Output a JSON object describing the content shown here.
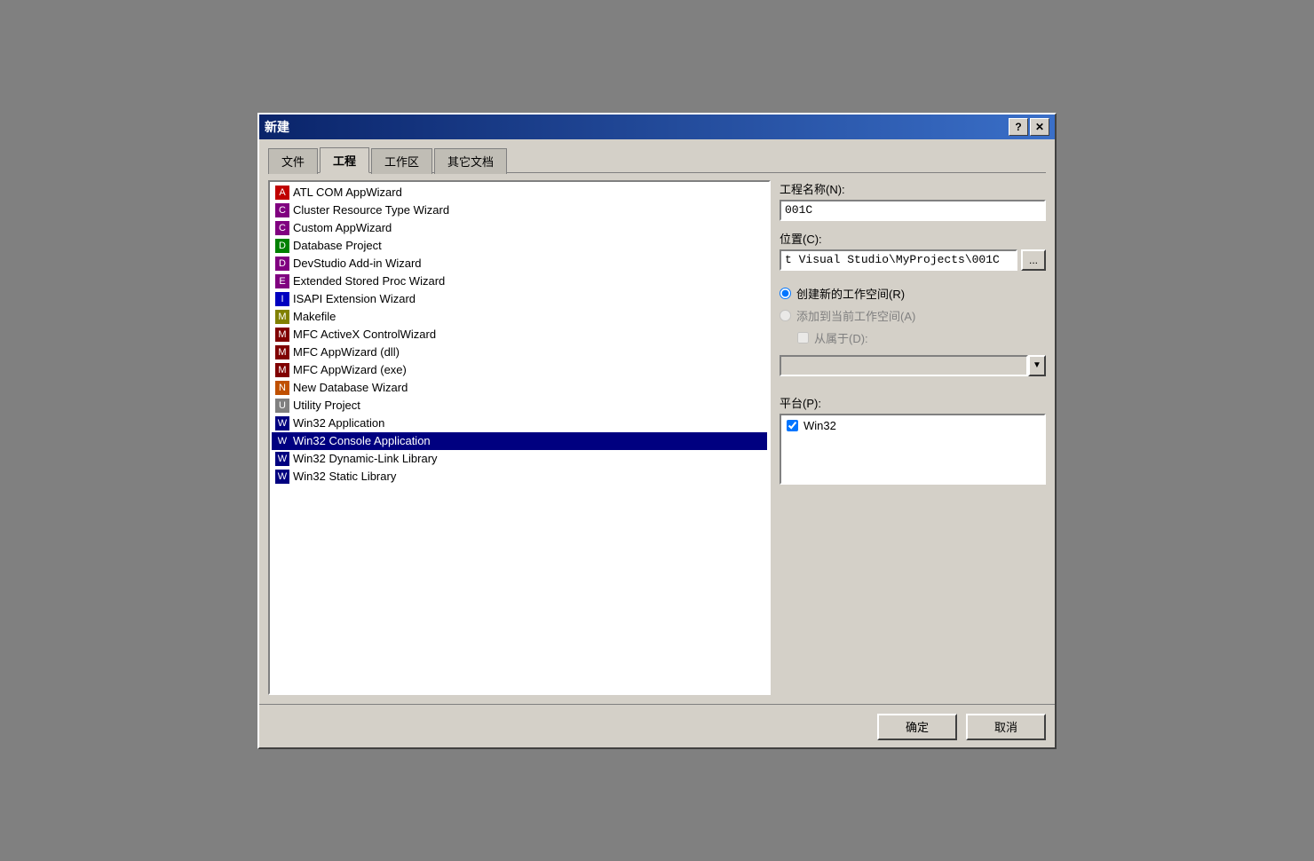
{
  "dialog": {
    "title": "新建",
    "help_btn": "?",
    "close_btn": "✕"
  },
  "tabs": [
    {
      "label": "文件",
      "active": false
    },
    {
      "label": "工程",
      "active": true
    },
    {
      "label": "工作区",
      "active": false
    },
    {
      "label": "其它文档",
      "active": false
    }
  ],
  "project_list": {
    "items": [
      {
        "id": "atl-com",
        "label": "ATL COM AppWizard",
        "icon": "A",
        "selected": false
      },
      {
        "id": "cluster",
        "label": "Cluster Resource Type Wizard",
        "icon": "C",
        "selected": false
      },
      {
        "id": "custom",
        "label": "Custom AppWizard",
        "icon": "C",
        "selected": false
      },
      {
        "id": "database",
        "label": "Database Project",
        "icon": "D",
        "selected": false
      },
      {
        "id": "devstudio",
        "label": "DevStudio Add-in Wizard",
        "icon": "D",
        "selected": false
      },
      {
        "id": "stored",
        "label": "Extended Stored Proc Wizard",
        "icon": "E",
        "selected": false
      },
      {
        "id": "isapi",
        "label": "ISAPI Extension Wizard",
        "icon": "I",
        "selected": false
      },
      {
        "id": "makefile",
        "label": "Makefile",
        "icon": "M",
        "selected": false
      },
      {
        "id": "mfcax",
        "label": "MFC ActiveX ControlWizard",
        "icon": "M",
        "selected": false
      },
      {
        "id": "mfcdll",
        "label": "MFC AppWizard (dll)",
        "icon": "M",
        "selected": false
      },
      {
        "id": "mfcexe",
        "label": "MFC AppWizard (exe)",
        "icon": "M",
        "selected": false
      },
      {
        "id": "newdb",
        "label": "New Database Wizard",
        "icon": "N",
        "selected": false
      },
      {
        "id": "utility",
        "label": "Utility Project",
        "icon": "U",
        "selected": false
      },
      {
        "id": "win32app",
        "label": "Win32 Application",
        "icon": "W",
        "selected": false
      },
      {
        "id": "win32con",
        "label": "Win32 Console Application",
        "icon": "W",
        "selected": true
      },
      {
        "id": "win32dll",
        "label": "Win32 Dynamic-Link Library",
        "icon": "W",
        "selected": false
      },
      {
        "id": "win32lib",
        "label": "Win32 Static Library",
        "icon": "W",
        "selected": false
      }
    ]
  },
  "right_panel": {
    "project_name_label": "工程名称(N):",
    "project_name_value": "001C",
    "location_label": "位置(C):",
    "location_value": "t Visual Studio\\MyProjects\\001C",
    "browse_label": "...",
    "radio_new_workspace": "创建新的工作空间(R)",
    "radio_add_workspace": "添加到当前工作空间(A)",
    "checkbox_dependency": "从属于(D):",
    "dependency_value": "",
    "platform_label": "平台(P):",
    "platform_items": [
      {
        "label": "Win32",
        "checked": true
      }
    ]
  },
  "buttons": {
    "ok": "确定",
    "cancel": "取消"
  }
}
